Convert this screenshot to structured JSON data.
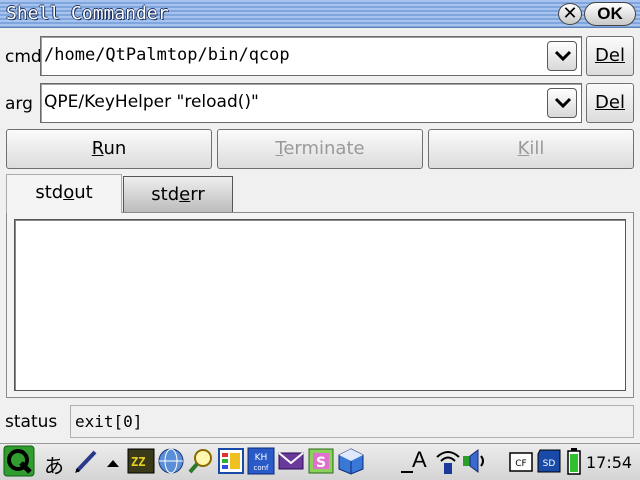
{
  "window": {
    "title": "Shell Commander",
    "close_glyph": "✕",
    "ok_label": "OK"
  },
  "cmd": {
    "label": "cmd",
    "value": "/home/QtPalmtop/bin/qcop",
    "del_label": "Del"
  },
  "arg": {
    "label": "arg",
    "value": "QPE/KeyHelper \"reload()\"",
    "del_label": "Del"
  },
  "actions": {
    "run": {
      "underline": "R",
      "rest": "un",
      "enabled": true
    },
    "terminate": {
      "underline": "T",
      "rest": "erminate",
      "enabled": false
    },
    "kill": {
      "underline": "K",
      "rest": "ill",
      "enabled": false
    }
  },
  "tabs": [
    {
      "pre": "std",
      "underline": "o",
      "post": "ut",
      "active": true
    },
    {
      "pre": "std",
      "underline": "e",
      "post": "rr",
      "active": false
    }
  ],
  "output": {
    "text": ""
  },
  "status": {
    "label": "status",
    "value": "exit[0]"
  },
  "taskbar": {
    "input_method": "あ",
    "indicator_letter": "A",
    "clock": "17:54",
    "app_icons": [
      "terminal-app-icon",
      "globe-app-icon",
      "magnifier-app-icon",
      "color-palette-app-icon",
      "khconf-app-icon",
      "mail-app-icon",
      "style-app-icon",
      "package-app-icon"
    ],
    "app_labels": {
      "khconf": "KH conf",
      "cf_card": "CF",
      "sd_card": "SD"
    },
    "colors": {
      "accent_blue": "#7fa5dd",
      "ok_green": "#22aa22",
      "battery_green": "#30c030"
    }
  }
}
